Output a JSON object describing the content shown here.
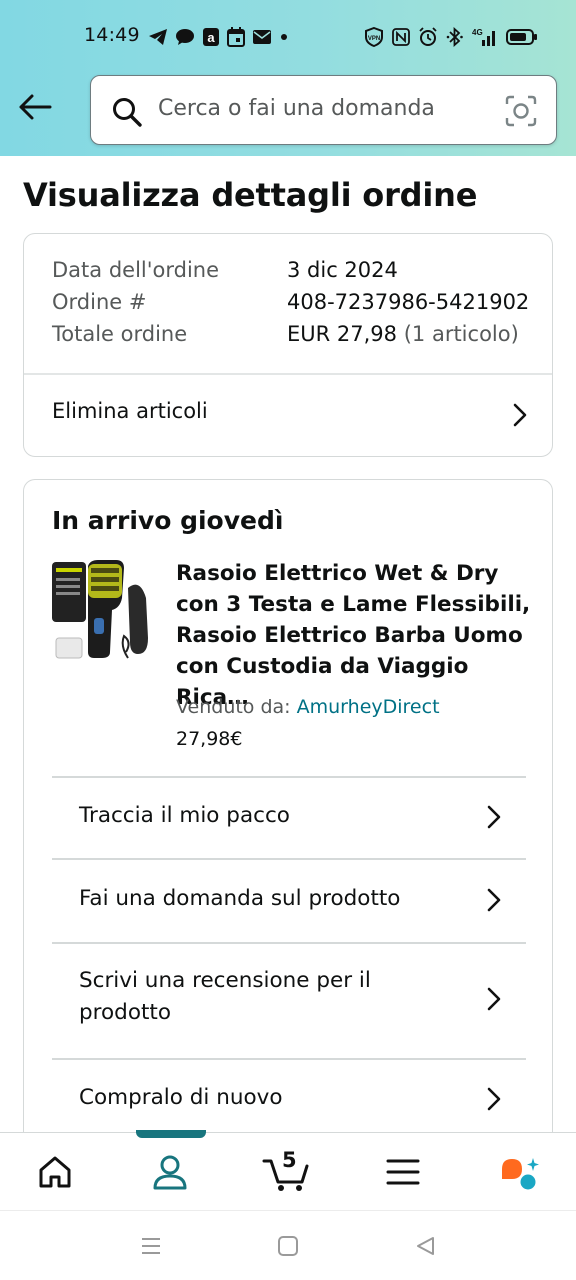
{
  "status_bar": {
    "time": "14:49"
  },
  "search": {
    "placeholder": "Cerca o fai una domanda"
  },
  "page": {
    "title": "Visualizza dettagli ordine"
  },
  "order": {
    "date_label": "Data dell'ordine",
    "date_value": "3 dic 2024",
    "number_label": "Ordine #",
    "number_value": "408-7237986-5421902",
    "total_label": "Totale ordine",
    "total_value": "EUR 27,98",
    "total_items": "(1 articolo)",
    "delete_items": "Elimina articoli"
  },
  "shipment": {
    "arrival": "In arrivo giovedì",
    "product_title": "Rasoio Elettrico Wet & Dry con 3 Testa e Lame Flessibili, Rasoio Elettrico Barba Uomo con Custodia da Viaggio Rica…",
    "sold_by_label": "Venduto da:",
    "seller": "AmurheyDirect",
    "price": "27,98€",
    "actions": [
      {
        "label": "Traccia il mio pacco"
      },
      {
        "label": "Fai una domanda sul prodotto"
      },
      {
        "label": "Scrivi una recensione per il prodotto"
      },
      {
        "label": "Compralo di nuovo"
      }
    ]
  },
  "bottom_nav": {
    "cart_count": "5"
  },
  "colors": {
    "accent": "#18757e",
    "link": "#007185",
    "header_start": "#82d8e3",
    "header_end": "#a6e4d4"
  }
}
